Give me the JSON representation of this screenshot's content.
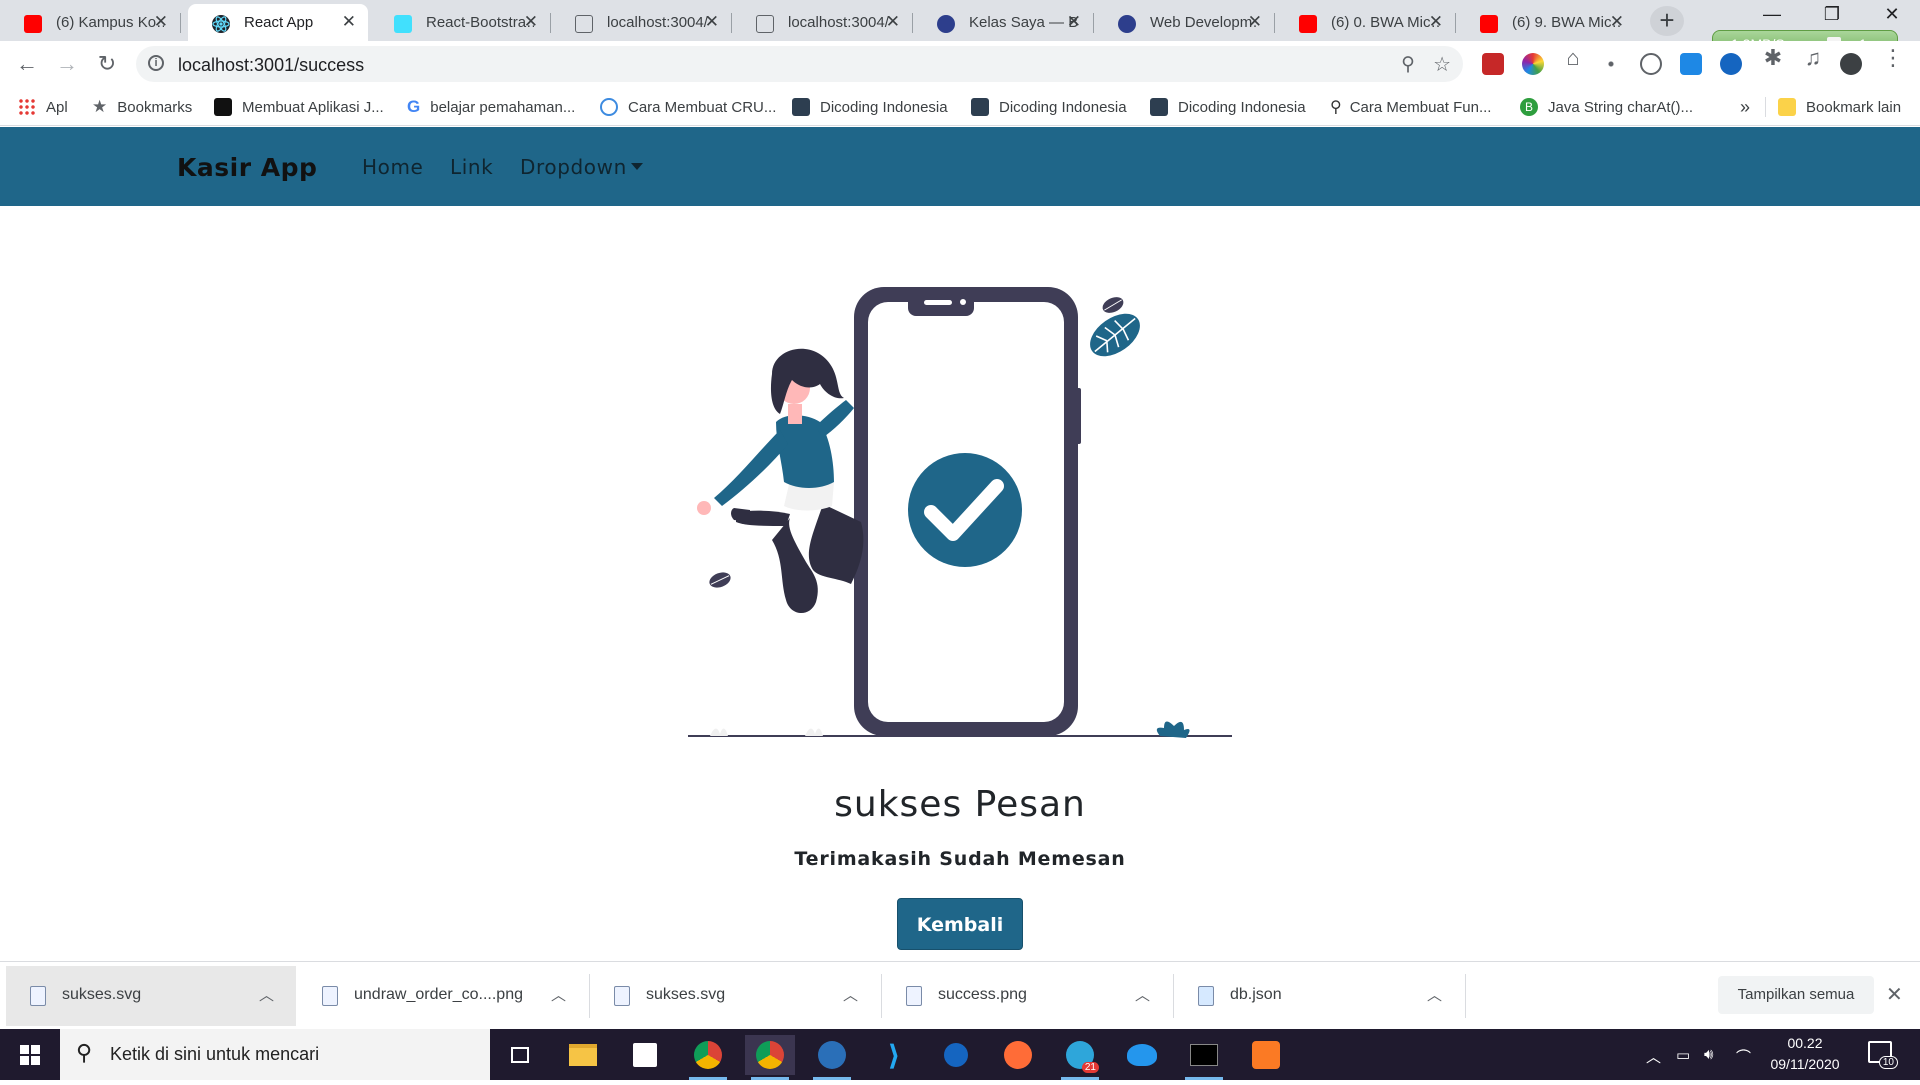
{
  "browser": {
    "tabs": [
      {
        "title": "(6) Kampus Ko…",
        "icon": "youtube-icon"
      },
      {
        "title": "React App",
        "icon": "react-icon",
        "active": true
      },
      {
        "title": "React-Bootstra…",
        "icon": "react-bootstrap-icon"
      },
      {
        "title": "localhost:3004/",
        "icon": "globe-icon"
      },
      {
        "title": "localhost:3004/",
        "icon": "globe-icon"
      },
      {
        "title": "Kelas Saya — B…",
        "icon": "dicoding-icon"
      },
      {
        "title": "Web Developm…",
        "icon": "dicoding-icon"
      },
      {
        "title": "(6) 0. BWA Mic…",
        "icon": "youtube-icon"
      },
      {
        "title": "(6) 9. BWA Mic…",
        "icon": "youtube-icon"
      }
    ],
    "network_speed": "1.3MB/S",
    "network_count": "1",
    "url": "localhost:3001/success",
    "bookmarks": [
      {
        "label": "Apl",
        "icon": "apps-grid-icon"
      },
      {
        "label": "Bookmarks",
        "icon": "star-icon"
      },
      {
        "label": "Membuat Aplikasi J...",
        "icon": "video-icon"
      },
      {
        "label": "belajar pemahaman...",
        "icon": "google-icon"
      },
      {
        "label": "Cara Membuat CRU...",
        "icon": "web-icon"
      },
      {
        "label": "Dicoding Indonesia",
        "icon": "dicoding-icon"
      },
      {
        "label": "Dicoding Indonesia",
        "icon": "dicoding-icon"
      },
      {
        "label": "Dicoding Indonesia",
        "icon": "dicoding-icon"
      },
      {
        "label": "Cara Membuat Fun...",
        "icon": "code-icon"
      },
      {
        "label": "Java String charAt()...",
        "icon": "bootstrap-icon"
      }
    ],
    "bookmarks_more": "»",
    "bookmarks_other": "Bookmark lain"
  },
  "app": {
    "brand": "Kasir App",
    "nav": [
      "Home",
      "Link",
      "Dropdown"
    ],
    "title": "sukses Pesan",
    "subtitle": "Terimakasih Sudah Memesan",
    "back_button": "Kembali",
    "colors": {
      "primary": "#1f6689",
      "dark": "#3f3d56",
      "skin": "#ffb8b8"
    }
  },
  "downloads": {
    "items": [
      "sukses.svg",
      "undraw_order_co....png",
      "sukses.svg",
      "success.png",
      "db.json"
    ],
    "show_all": "Tampilkan semua"
  },
  "taskbar": {
    "search_placeholder": "Ketik di sini untuk mencari",
    "telegram_badge": "21",
    "time": "00.22",
    "date": "09/11/2020",
    "notifications": "10"
  }
}
